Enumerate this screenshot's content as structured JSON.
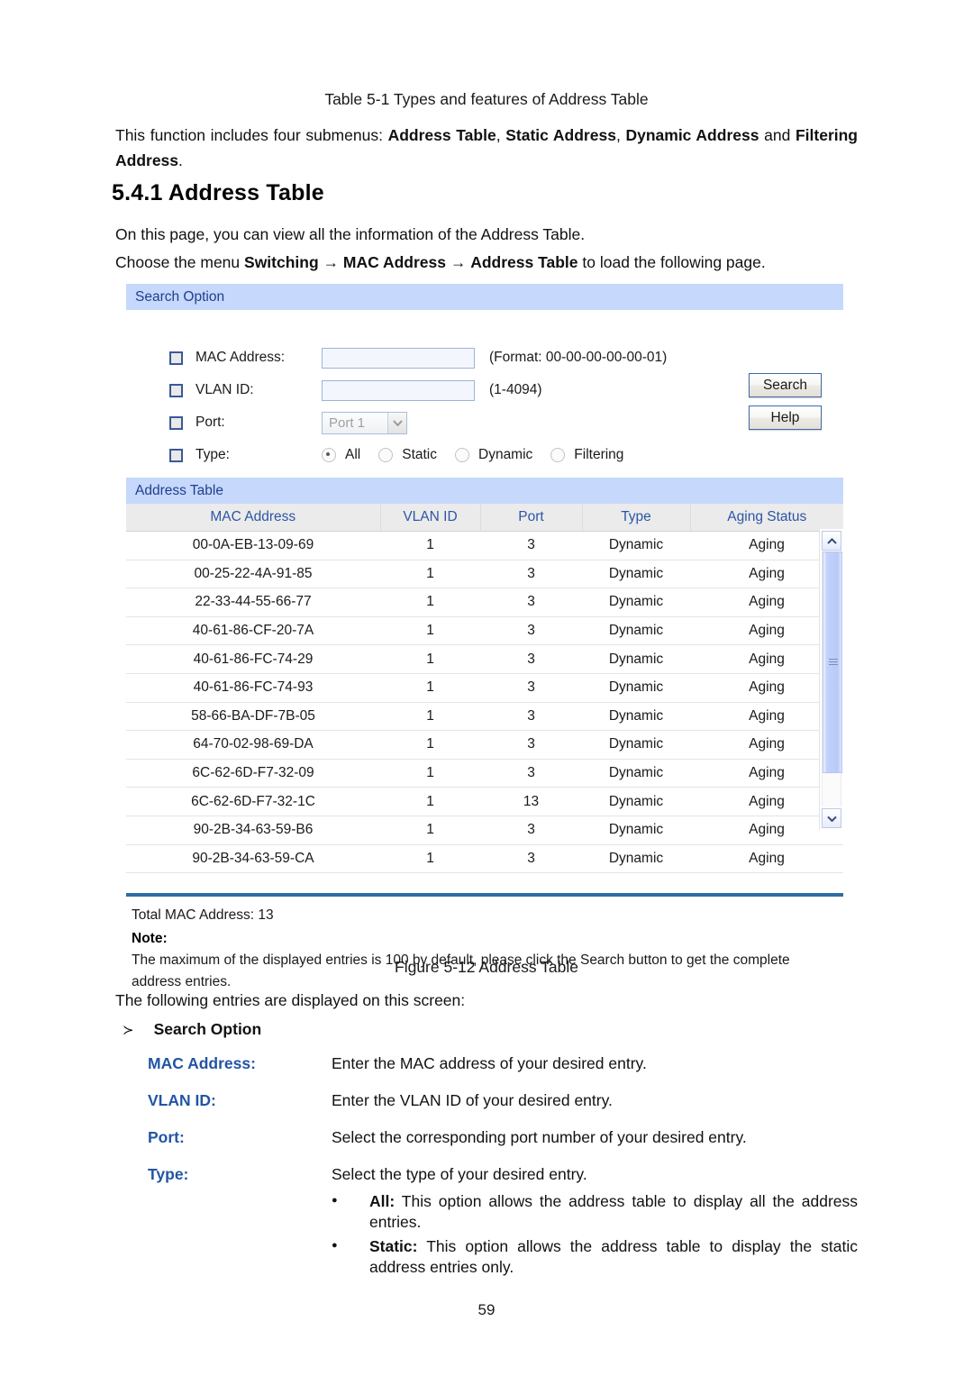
{
  "document": {
    "table_caption": "Table 5-1 Types and features of Address Table",
    "intro_prefix": "This function includes four submenus: ",
    "submenu_1": "Address Table",
    "submenu_2": "Static Address",
    "submenu_3": "Dynamic Address",
    "submenu_4": "Filtering Address",
    "intro_sep1": ", ",
    "intro_sep2": ", ",
    "intro_and": " and ",
    "intro_period": ".",
    "heading": "5.4.1 Address Table",
    "para_overview": "On this page, you can view all the information of the Address Table.",
    "para_choose_prefix": "Choose the menu ",
    "menu_path_1": "Switching",
    "menu_arrow_1": " → ",
    "menu_path_2": "MAC Address",
    "menu_arrow_2": " → ",
    "menu_path_3": "Address Table",
    "para_choose_suffix": " to load the following page.",
    "figure_caption": "Figure 5-12 Address Table",
    "page_number": "59"
  },
  "search_option": {
    "panel_title": "Search Option",
    "fields": {
      "mac_address": {
        "label": "MAC Address:",
        "value": "",
        "placeholder": "",
        "hint": "(Format: 00-00-00-00-00-01)",
        "checked": false
      },
      "vlan_id": {
        "label": "VLAN ID:",
        "value": "",
        "placeholder": "",
        "hint": "(1-4094)",
        "checked": false
      },
      "port": {
        "label": "Port:",
        "selected": "Port 1",
        "checked": false,
        "disabled": true
      },
      "type": {
        "label": "Type:",
        "checked": false,
        "options": [
          "All",
          "Static",
          "Dynamic",
          "Filtering"
        ],
        "selected": "All"
      }
    },
    "buttons": {
      "search": "Search",
      "help": "Help"
    }
  },
  "address_table": {
    "panel_title": "Address Table",
    "columns": [
      "MAC Address",
      "VLAN ID",
      "Port",
      "Type",
      "Aging Status"
    ],
    "rows": [
      [
        "00-0A-EB-13-09-69",
        "1",
        "3",
        "Dynamic",
        "Aging"
      ],
      [
        "00-25-22-4A-91-85",
        "1",
        "3",
        "Dynamic",
        "Aging"
      ],
      [
        "22-33-44-55-66-77",
        "1",
        "3",
        "Dynamic",
        "Aging"
      ],
      [
        "40-61-86-CF-20-7A",
        "1",
        "3",
        "Dynamic",
        "Aging"
      ],
      [
        "40-61-86-FC-74-29",
        "1",
        "3",
        "Dynamic",
        "Aging"
      ],
      [
        "40-61-86-FC-74-93",
        "1",
        "3",
        "Dynamic",
        "Aging"
      ],
      [
        "58-66-BA-DF-7B-05",
        "1",
        "3",
        "Dynamic",
        "Aging"
      ],
      [
        "64-70-02-98-69-DA",
        "1",
        "3",
        "Dynamic",
        "Aging"
      ],
      [
        "6C-62-6D-F7-32-09",
        "1",
        "3",
        "Dynamic",
        "Aging"
      ],
      [
        "6C-62-6D-F7-32-1C",
        "1",
        "13",
        "Dynamic",
        "Aging"
      ],
      [
        "90-2B-34-63-59-B6",
        "1",
        "3",
        "Dynamic",
        "Aging"
      ],
      [
        "90-2B-34-63-59-CA",
        "1",
        "3",
        "Dynamic",
        "Aging"
      ]
    ],
    "total_label": "Total MAC Address: 13",
    "note_title": "Note:",
    "note_body": "The maximum of the displayed entries is 100 by default, please click the Search button to get the complete address entries."
  },
  "description": {
    "lead": "The following entries are displayed on this screen:",
    "section_arrow": "≻",
    "section_title": "Search Option",
    "entries": [
      {
        "term": "MAC Address:",
        "desc": "Enter the MAC address of your desired entry."
      },
      {
        "term": "VLAN ID:",
        "desc": "Enter the VLAN ID of your desired entry."
      },
      {
        "term": "Port:",
        "desc": "Select the corresponding port number of your desired entry."
      },
      {
        "term": "Type:",
        "desc": "Select the type of your desired entry."
      }
    ],
    "sub_bullets": [
      {
        "term": "All:",
        "desc": " This option allows the address table to display all the address entries."
      },
      {
        "term": "Static:",
        "desc": " This option allows the address table to display the static address entries only."
      }
    ]
  },
  "colors": {
    "panel_title_bg": "#c6d8fb",
    "panel_title_text": "#1f3f8f",
    "table_header_bg": "#ebebeb",
    "table_header_text": "#2d55a5",
    "divider": "#2e6da4",
    "term_text": "#2255a4",
    "scrollbar_thumb": "#bdcdf9"
  }
}
